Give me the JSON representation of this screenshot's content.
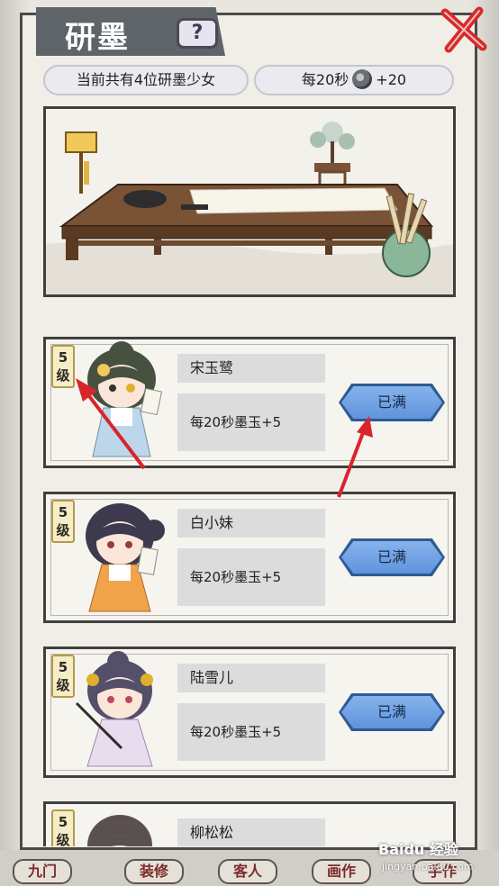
{
  "header": {
    "title": "研墨",
    "help_label": "?"
  },
  "info": {
    "count_text": "当前共有4位研墨少女",
    "rate_prefix": "每20秒",
    "rate_suffix": "+20"
  },
  "girls": [
    {
      "level_digit": "5",
      "level_char": "级",
      "name": "宋玉鹭",
      "rate": "每20秒墨玉+5",
      "status": "已满"
    },
    {
      "level_digit": "5",
      "level_char": "级",
      "name": "白小妹",
      "rate": "每20秒墨玉+5",
      "status": "已满"
    },
    {
      "level_digit": "5",
      "level_char": "级",
      "name": "陆雪儿",
      "rate": "每20秒墨玉+5",
      "status": "已满"
    },
    {
      "level_digit": "5",
      "level_char": "级",
      "name": "柳松松",
      "rate": "",
      "status": ""
    }
  ],
  "bottom_tabs": [
    "九门",
    "装修",
    "客人",
    "画作",
    "手作"
  ],
  "watermark": {
    "brand": "Baidu 经验",
    "url": "jingyan.baidu.com"
  },
  "colors": {
    "button_blue": "#6f9fe4",
    "panel_bg": "#f1eee8",
    "arrow_red": "#d9242c"
  }
}
